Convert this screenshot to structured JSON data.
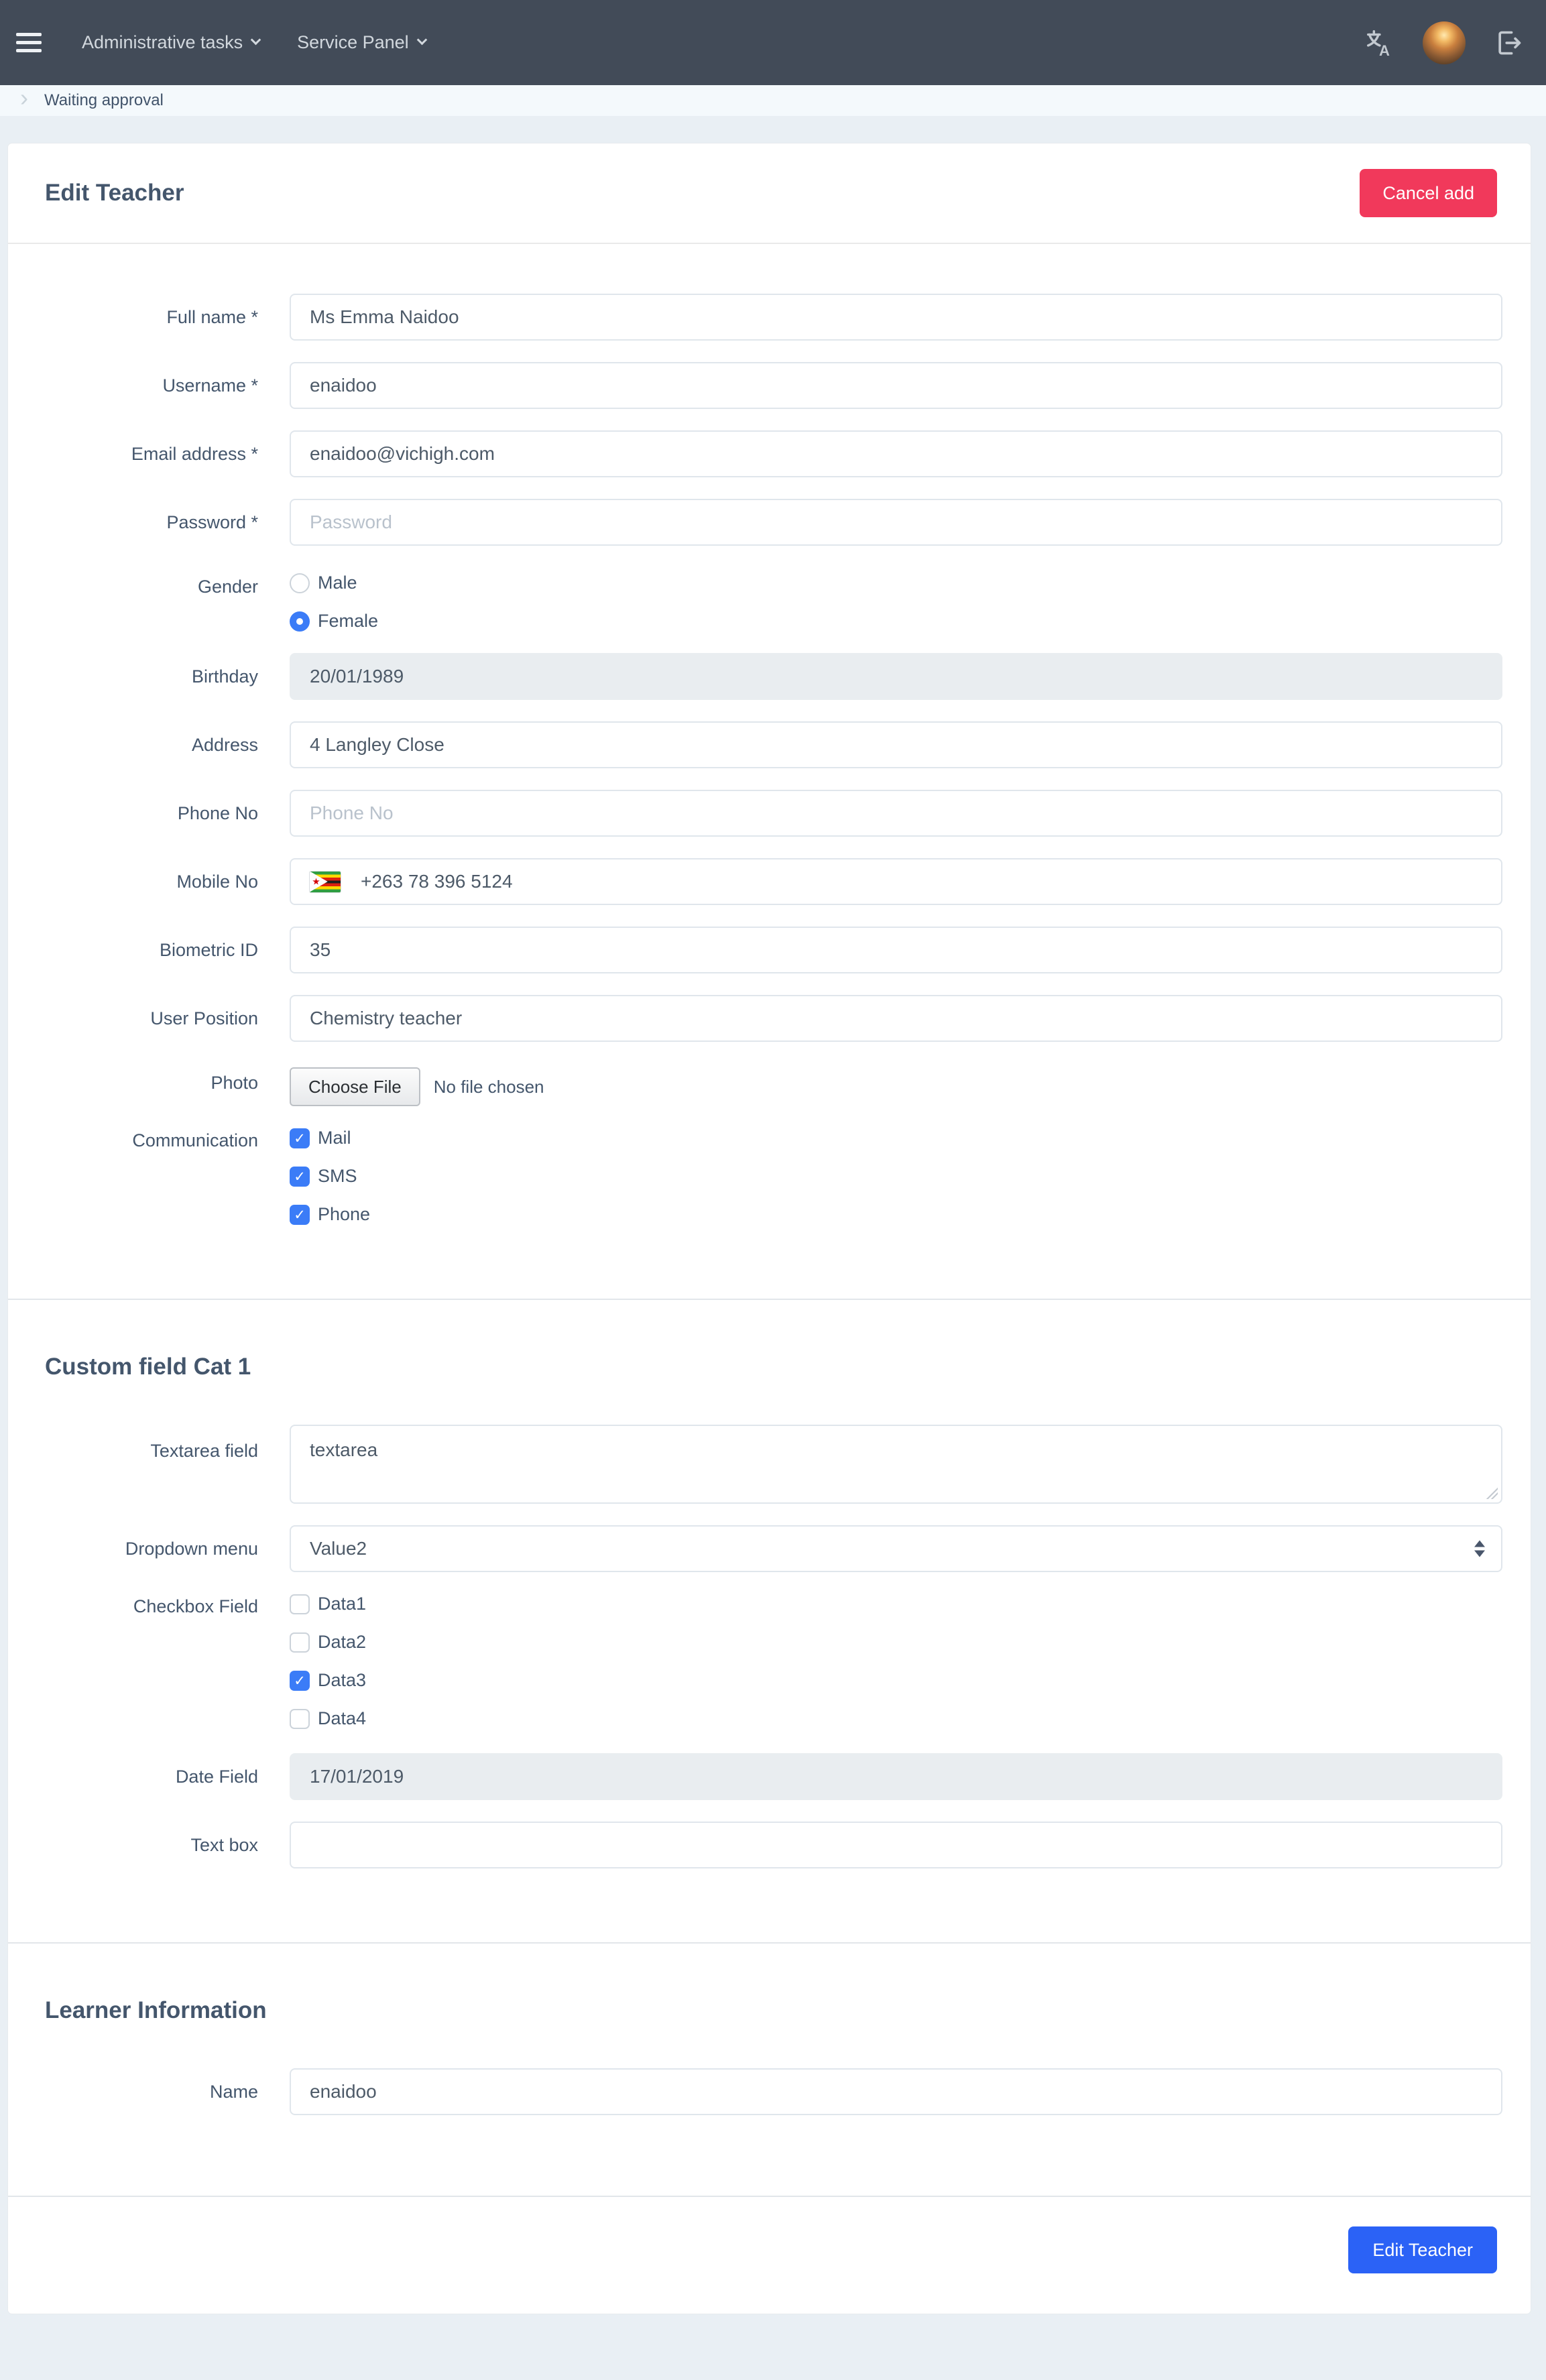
{
  "navbar": {
    "items": [
      {
        "label": "Administrative tasks"
      },
      {
        "label": "Service Panel"
      }
    ]
  },
  "breadcrumb": {
    "current": "Waiting approval"
  },
  "header": {
    "title": "Edit Teacher",
    "cancel_button": "Cancel add"
  },
  "form": {
    "full_name": {
      "label": "Full name *",
      "value": "Ms Emma Naidoo"
    },
    "username": {
      "label": "Username *",
      "value": "enaidoo"
    },
    "email": {
      "label": "Email address *",
      "value": "enaidoo@vichigh.com"
    },
    "password": {
      "label": "Password *",
      "placeholder": "Password"
    },
    "gender": {
      "label": "Gender",
      "options": [
        {
          "label": "Male",
          "checked": false
        },
        {
          "label": "Female",
          "checked": true
        }
      ]
    },
    "birthday": {
      "label": "Birthday",
      "value": "20/01/1989",
      "readonly": true
    },
    "address": {
      "label": "Address",
      "value": "4 Langley Close"
    },
    "phone": {
      "label": "Phone No",
      "placeholder": "Phone No"
    },
    "mobile": {
      "label": "Mobile No",
      "value": "+263 78 396 5124",
      "flag": "zimbabwe-flag"
    },
    "biometric_id": {
      "label": "Biometric ID",
      "value": "35"
    },
    "user_position": {
      "label": "User Position",
      "value": "Chemistry teacher"
    },
    "photo": {
      "label": "Photo",
      "button": "Choose File",
      "status": "No file chosen"
    },
    "communication": {
      "label": "Communication",
      "options": [
        {
          "label": "Mail",
          "checked": true
        },
        {
          "label": "SMS",
          "checked": true
        },
        {
          "label": "Phone",
          "checked": true
        }
      ]
    }
  },
  "custom_section": {
    "title": "Custom field Cat 1",
    "textarea": {
      "label": "Textarea field",
      "value": "textarea"
    },
    "dropdown": {
      "label": "Dropdown menu",
      "value": "Value2"
    },
    "checkbox_field": {
      "label": "Checkbox Field",
      "options": [
        {
          "label": "Data1",
          "checked": false
        },
        {
          "label": "Data2",
          "checked": false
        },
        {
          "label": "Data3",
          "checked": true
        },
        {
          "label": "Data4",
          "checked": false
        }
      ]
    },
    "date_field": {
      "label": "Date Field",
      "value": "17/01/2019",
      "readonly": true
    },
    "text_box": {
      "label": "Text box",
      "value": ""
    }
  },
  "learner_section": {
    "title": "Learner Information",
    "name": {
      "label": "Name",
      "value": "enaidoo"
    }
  },
  "footer": {
    "submit_button": "Edit Teacher"
  },
  "colors": {
    "topbar": "#424b58",
    "page_background": "#e9eff4",
    "accent_red": "#f1395b",
    "accent_blue": "#2b62f6",
    "control_blue": "#3b7cf7"
  }
}
